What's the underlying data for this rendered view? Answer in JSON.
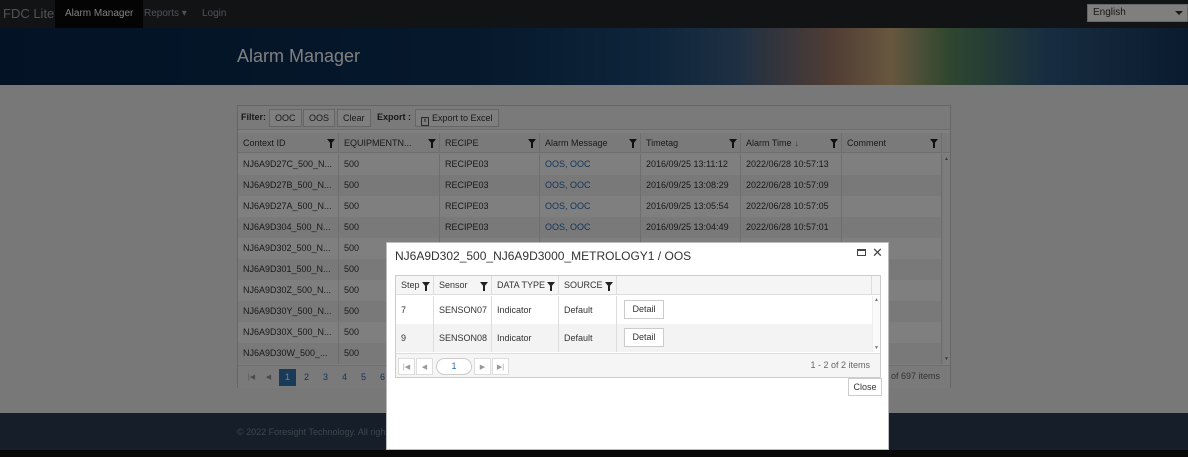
{
  "navbar": {
    "brand": "FDC Lite",
    "items": [
      {
        "label": "Alarm Manager"
      },
      {
        "label": "Reports ▾"
      },
      {
        "label": "Login"
      }
    ],
    "language": "English"
  },
  "hero": {
    "title": "Alarm Manager"
  },
  "toolbar": {
    "filter_label": "Filter:",
    "ooc": "OOC",
    "oos": "OOS",
    "clear": "Clear",
    "export_label": "Export :",
    "export_excel": "Export to Excel"
  },
  "grid": {
    "columns": [
      "Context ID",
      "EQUIPMENTN...",
      "RECIPE",
      "Alarm Message",
      "Timetag",
      "Alarm Time",
      "Comment"
    ],
    "sort_indicator": "↓",
    "rows": [
      [
        "NJ6A9D27C_500_N...",
        "500",
        "RECIPE03",
        "OOS, OOC",
        "2016/09/25 13:11:12",
        "2022/06/28 10:57:13",
        ""
      ],
      [
        "NJ6A9D27B_500_N...",
        "500",
        "RECIPE03",
        "OOS, OOC",
        "2016/09/25 13:08:29",
        "2022/06/28 10:57:09",
        ""
      ],
      [
        "NJ6A9D27A_500_N...",
        "500",
        "RECIPE03",
        "OOS, OOC",
        "2016/09/25 13:05:54",
        "2022/06/28 10:57:05",
        ""
      ],
      [
        "NJ6A9D304_500_N...",
        "500",
        "RECIPE03",
        "OOS, OOC",
        "2016/09/25 13:04:49",
        "2022/06/28 10:57:01",
        ""
      ],
      [
        "NJ6A9D302_500_N...",
        "500",
        "",
        "",
        "",
        "",
        ""
      ],
      [
        "NJ6A9D301_500_N...",
        "500",
        "",
        "",
        "",
        "",
        ""
      ],
      [
        "NJ6A9D30Z_500_N...",
        "500",
        "",
        "",
        "",
        "",
        ""
      ],
      [
        "NJ6A9D30Y_500_N...",
        "500",
        "",
        "",
        "",
        "",
        ""
      ],
      [
        "NJ6A9D30X_500_N...",
        "500",
        "",
        "",
        "",
        "",
        ""
      ],
      [
        "NJ6A9D30W_500_...",
        "500",
        "",
        "",
        "",
        "",
        ""
      ]
    ],
    "pages": [
      "1",
      "2",
      "3",
      "4",
      "5",
      "6"
    ],
    "current_page": "1",
    "pager_info": "of 697 items"
  },
  "footer": {
    "copyright": "© 2022 Foresight Technology. All right"
  },
  "modal": {
    "title": "NJ6A9D302_500_NJ6A9D3000_METROLOGY1 / OOS",
    "columns": [
      "Step",
      "Sensor",
      "DATA TYPE",
      "SOURCE"
    ],
    "rows": [
      {
        "step": "7",
        "sensor": "SENSON07",
        "data_type": "Indicator",
        "source": "Default",
        "action": "Detail"
      },
      {
        "step": "9",
        "sensor": "SENSON08",
        "data_type": "Indicator",
        "source": "Default",
        "action": "Detail"
      }
    ],
    "current_page": "1",
    "pager_info": "1 - 2 of 2 items",
    "close_label": "Close"
  }
}
